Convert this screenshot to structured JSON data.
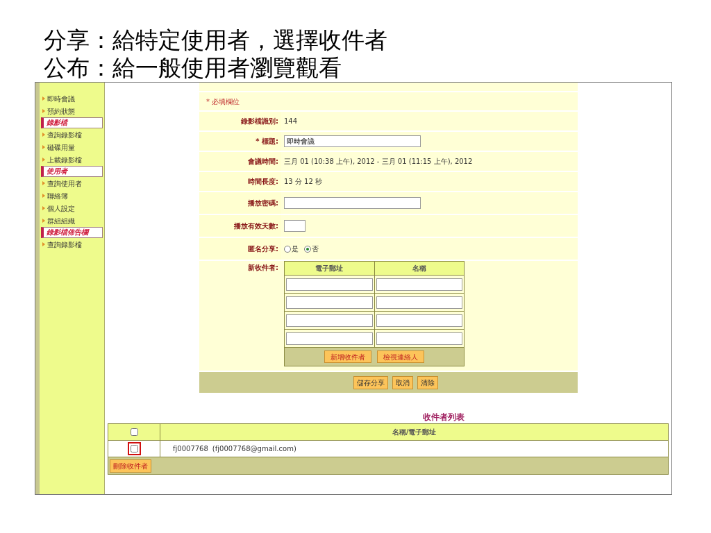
{
  "slide_title_lines": [
    "分享：給特定使用者，選擇收件者",
    "公布：給一般使用者瀏覽觀看"
  ],
  "sidebar": {
    "items": [
      {
        "kind": "link",
        "label": "即時會議"
      },
      {
        "kind": "link",
        "label": "預約狀態"
      },
      {
        "kind": "section",
        "label": "錄影檔"
      },
      {
        "kind": "link",
        "label": "查詢錄影檔"
      },
      {
        "kind": "link",
        "label": "磁碟用量"
      },
      {
        "kind": "link",
        "label": "上載錄影檔"
      },
      {
        "kind": "section",
        "label": "使用者"
      },
      {
        "kind": "link",
        "label": "查詢使用者"
      },
      {
        "kind": "link",
        "label": "聯絡簿"
      },
      {
        "kind": "link",
        "label": "個人設定"
      },
      {
        "kind": "link",
        "label": "群組組織"
      },
      {
        "kind": "section",
        "label": "錄影檔佈告欄"
      },
      {
        "kind": "link",
        "label": "查詢錄影檔"
      }
    ]
  },
  "form": {
    "required_note": "* 必填欄位",
    "fields": [
      {
        "kind": "text",
        "label": "錄影檔識別:",
        "value": "144"
      },
      {
        "kind": "input",
        "label": "* 標題:",
        "value": "即時會議"
      },
      {
        "kind": "text",
        "label": "會議時間:",
        "value": "三月 01 (10:38 上午), 2012 - 三月 01 (11:15 上午), 2012"
      },
      {
        "kind": "text",
        "label": "時間長度:",
        "value": "13 分 12 秒"
      },
      {
        "kind": "input",
        "label": "播放密碼:"
      },
      {
        "kind": "short_input",
        "label": "播放有效天數:"
      },
      {
        "kind": "radio",
        "label": "匿名分享:",
        "options": [
          {
            "label": "是",
            "selected": false
          },
          {
            "label": "否",
            "selected": true
          }
        ]
      }
    ],
    "new_recipients": {
      "label": "新收件者:",
      "columns": [
        "電子郵址",
        "名稱"
      ],
      "buttons": [
        "新增收件者",
        "檢視連絡人"
      ]
    },
    "buttons": [
      "儲存分享",
      "取消",
      "清除"
    ]
  },
  "recipient_list": {
    "title": "收件者列表",
    "header": {
      "checked": false,
      "column": "名稱/電子郵址"
    },
    "rows": [
      {
        "checked": false,
        "highlighted": true,
        "name": "fj0007768",
        "email": "(fj0007768@gmail.com)"
      }
    ],
    "delete_button": "刪除收件者"
  }
}
